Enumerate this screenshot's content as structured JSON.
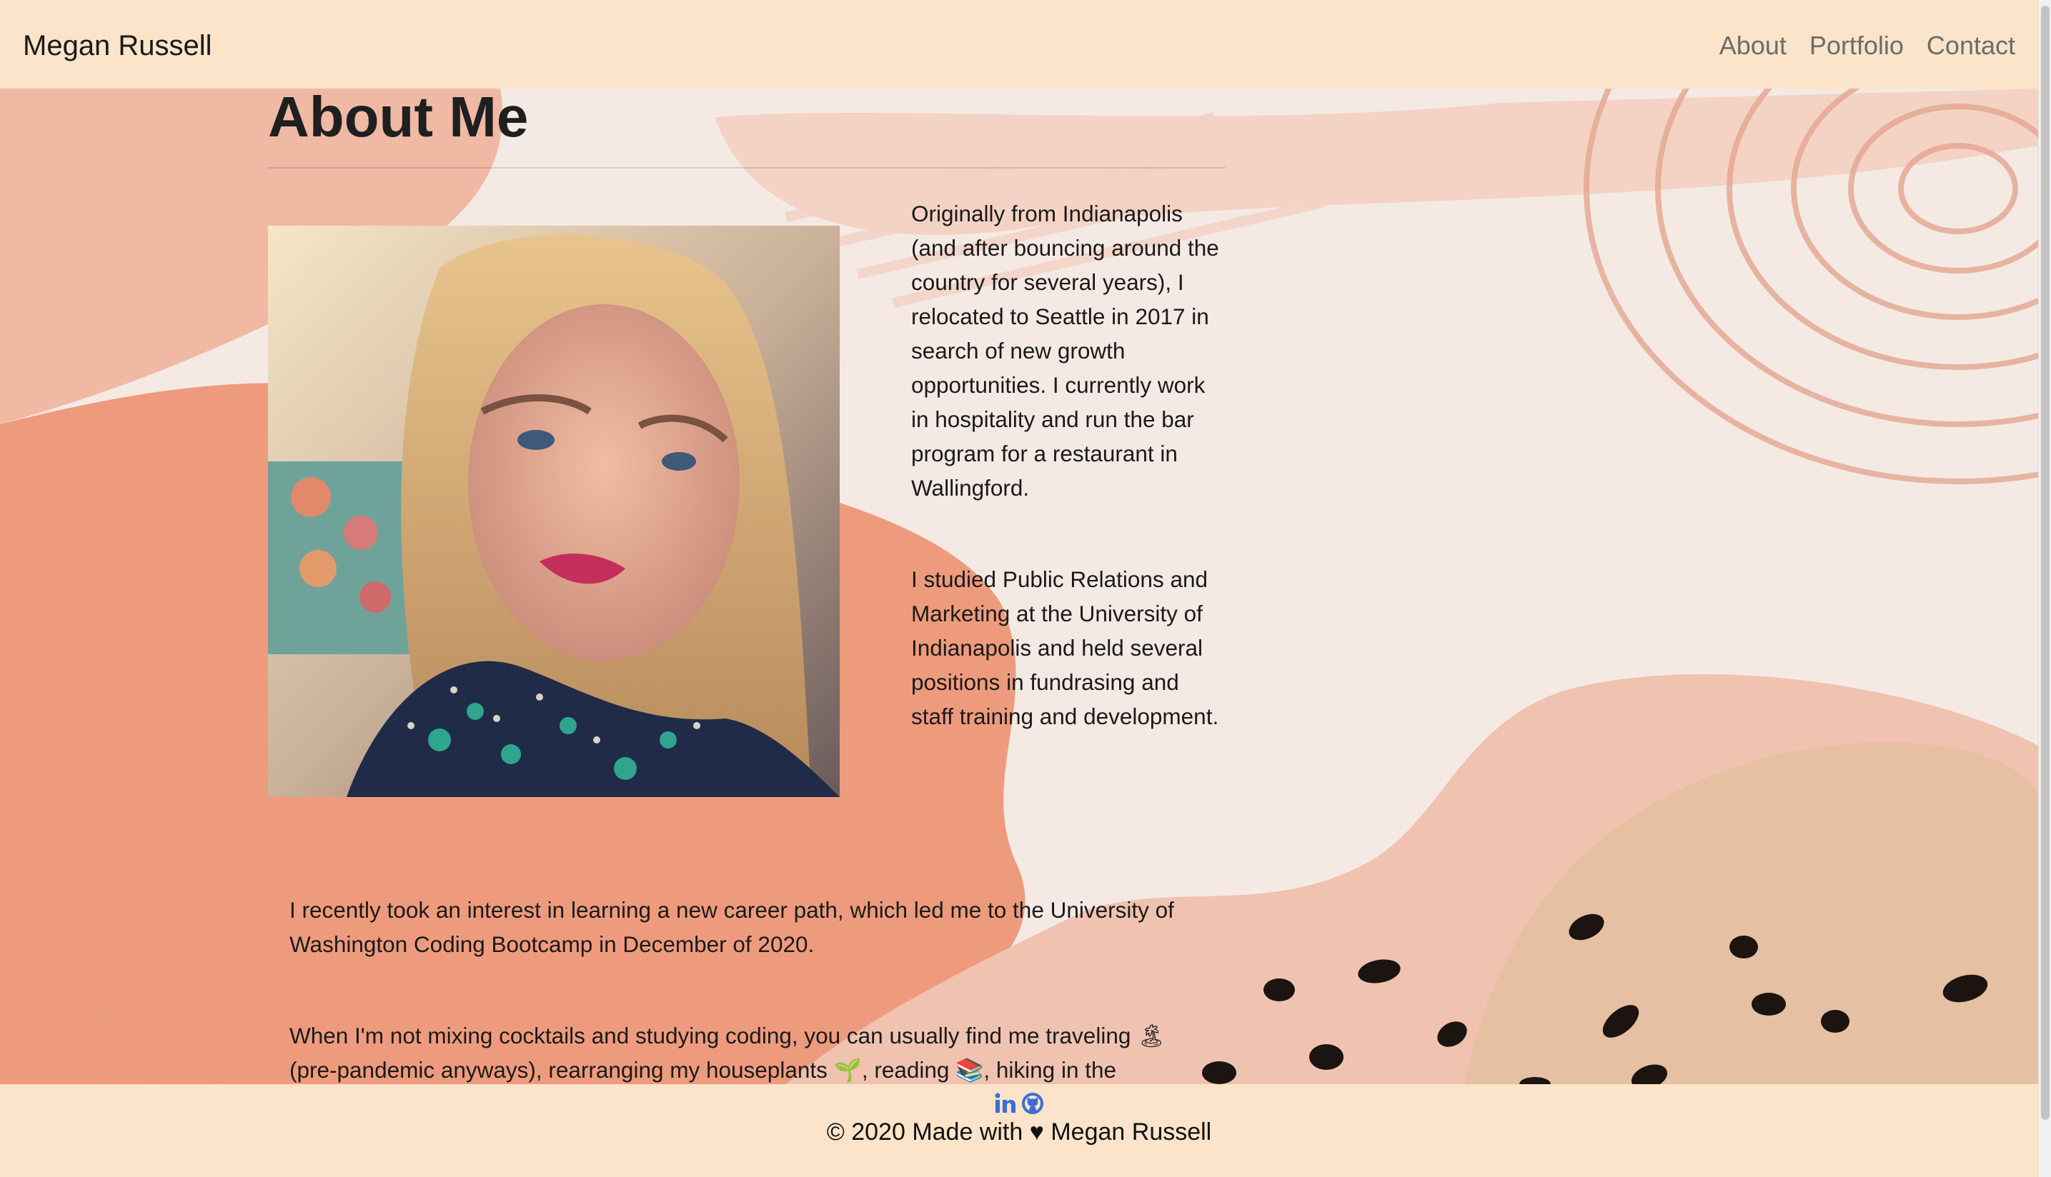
{
  "navbar": {
    "brand": "Megan Russell",
    "links": [
      "About",
      "Portfolio",
      "Contact"
    ]
  },
  "main": {
    "title": "About Me",
    "bio_paragraphs": [
      "Originally from Indianapolis (and after bouncing around the country for several years), I relocated to Seattle in 2017 in search of new growth opportunities. I currently work in hospitality and run the bar program for a restaurant in Wallingford.",
      "I studied Public Relations and Marketing at the University of Indianapolis and held several positions in fundrasing and staff training and development."
    ],
    "full_paragraphs": [
      "I recently took an interest in learning a new career path, which led me to the University of Washington Coding Bootcamp in December of 2020.",
      "When I'm not mixing cocktails and studying coding, you can usually find me traveling 🏝 (pre-pandemic anyways), rearranging my houseplants 🌱, reading 📚, hiking in the"
    ]
  },
  "footer": {
    "social_icons": [
      "linkedin-icon",
      "github-icon"
    ],
    "copyright": "© 2020 Made with ♥ Megan Russell"
  },
  "colors": {
    "header_bg": "#fbe4c9",
    "accent_link": "#3b6ed6"
  }
}
